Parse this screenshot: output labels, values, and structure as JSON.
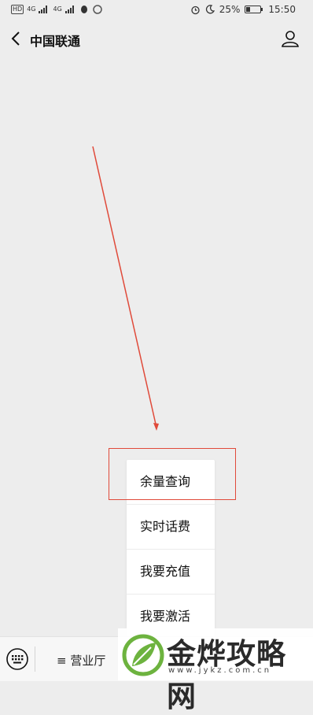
{
  "status_bar": {
    "left_badges": [
      "HD",
      "4G",
      "4G"
    ],
    "battery": "25%",
    "time": "15:50"
  },
  "header": {
    "title": "中国联通"
  },
  "popup_menu": {
    "items": [
      "余量查询",
      "实时话费",
      "我要充值",
      "我要激活"
    ],
    "highlighted_item": "余量查询"
  },
  "bottom_bar": {
    "tab_label": "≡ 营业厅"
  },
  "watermark": {
    "text": "金烨攻略网",
    "url": "www.jykz.com.cn"
  },
  "colors": {
    "background": "#ededed",
    "annotation_red": "#e04a3a",
    "watermark_green": "#6db33f"
  }
}
